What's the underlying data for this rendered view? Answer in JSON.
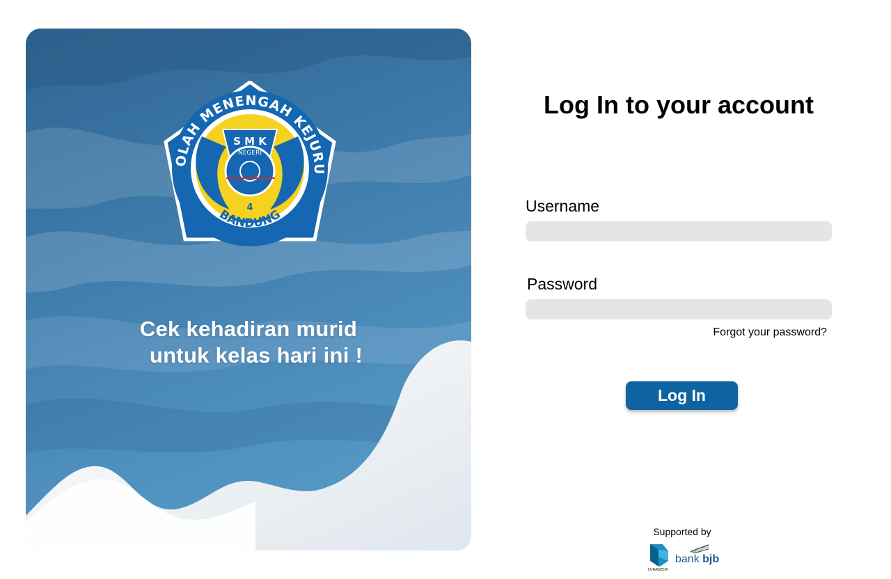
{
  "hero": {
    "tagline_line1": "Cek kehadiran murid",
    "tagline_line2": "untuk kelas hari ini !",
    "logo": {
      "top_text": "SEKOLAH MENENGAH KEJURUAN",
      "bottom_text": "BANDUNG",
      "inner_top": "S M K",
      "inner_sub": "NEGERI",
      "number": "4"
    }
  },
  "login": {
    "title": "Log In to your account",
    "username_label": "Username",
    "password_label": "Password",
    "forgot_link": "Forgot your password?",
    "submit_label": "Log In"
  },
  "footer": {
    "supported_by": "Supported by",
    "sponsors": [
      {
        "name": "CURAWEDA",
        "icon": "curaweda-logo-icon"
      },
      {
        "name_prefix": "bank",
        "name_suffix": "bjb",
        "icon": "bank-bjb-logo-icon"
      }
    ]
  },
  "colors": {
    "hero_dark": "#2f6592",
    "hero_light": "#5aa0cc",
    "button": "#0f63a0",
    "input_bg": "#e5e5e5",
    "logo_blue": "#1467b0",
    "logo_yellow": "#f5d21f"
  }
}
